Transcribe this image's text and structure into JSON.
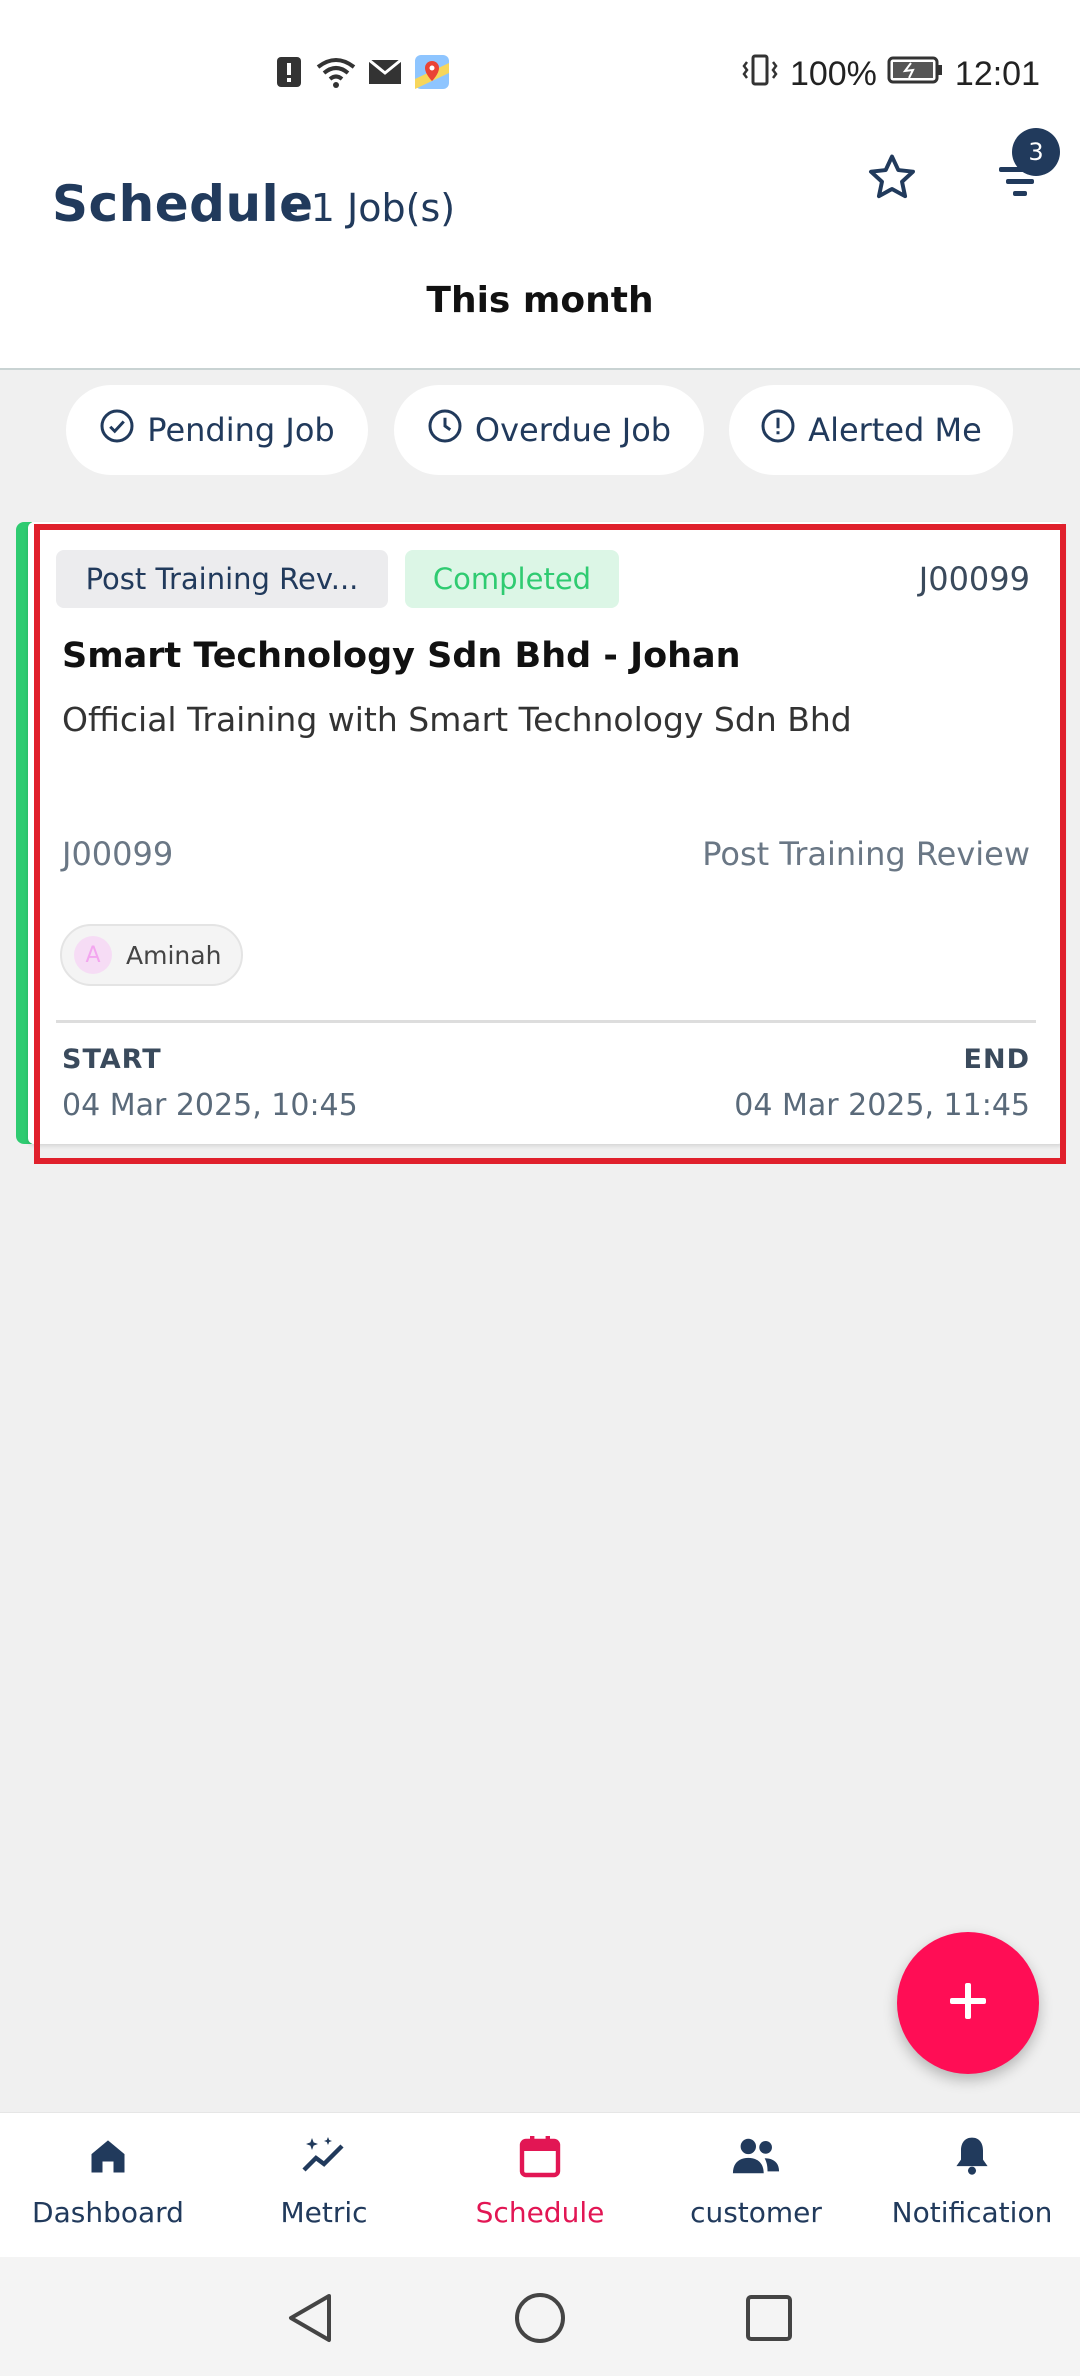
{
  "status_bar": {
    "battery": "100%",
    "time": "12:01",
    "icons": [
      "alert-icon",
      "wifi-icon",
      "mail-icon",
      "maps-icon",
      "vibrate-icon",
      "battery-icon"
    ]
  },
  "header": {
    "title": "Schedule",
    "subtitle": "- 1 Job(s)",
    "period": "This month",
    "filter_badge": "3"
  },
  "quick_filters": [
    {
      "label": "Pending Job",
      "icon": "check-circle-icon"
    },
    {
      "label": "Overdue Job",
      "icon": "clock-icon"
    },
    {
      "label": "Alerted Me",
      "icon": "alert-circle-icon"
    }
  ],
  "job": {
    "type_tag": "Post Training Rev...",
    "status": "Completed",
    "id_top": "J00099",
    "title": "Smart Technology Sdn Bhd - Johan",
    "description": "Official Training with Smart Technology Sdn Bhd",
    "id_bottom": "J00099",
    "type_bottom": "Post Training Review",
    "assignee_initial": "A",
    "assignee_name": "Aminah",
    "start_label": "START",
    "end_label": "END",
    "start_value": "04 Mar 2025, 10:45",
    "end_value": "04 Mar 2025, 11:45"
  },
  "nav": [
    {
      "label": "Dashboard",
      "icon": "home-icon"
    },
    {
      "label": "Metric",
      "icon": "sparkle-chart-icon"
    },
    {
      "label": "Schedule",
      "icon": "calendar-icon",
      "active": true
    },
    {
      "label": "customer",
      "icon": "people-icon"
    },
    {
      "label": "Notification",
      "icon": "bell-icon"
    }
  ],
  "colors": {
    "primary": "#213a5c",
    "accent": "#ff0d55",
    "active_nav": "#e21654",
    "completed": "#2fcb71",
    "highlight": "#e0202c"
  }
}
